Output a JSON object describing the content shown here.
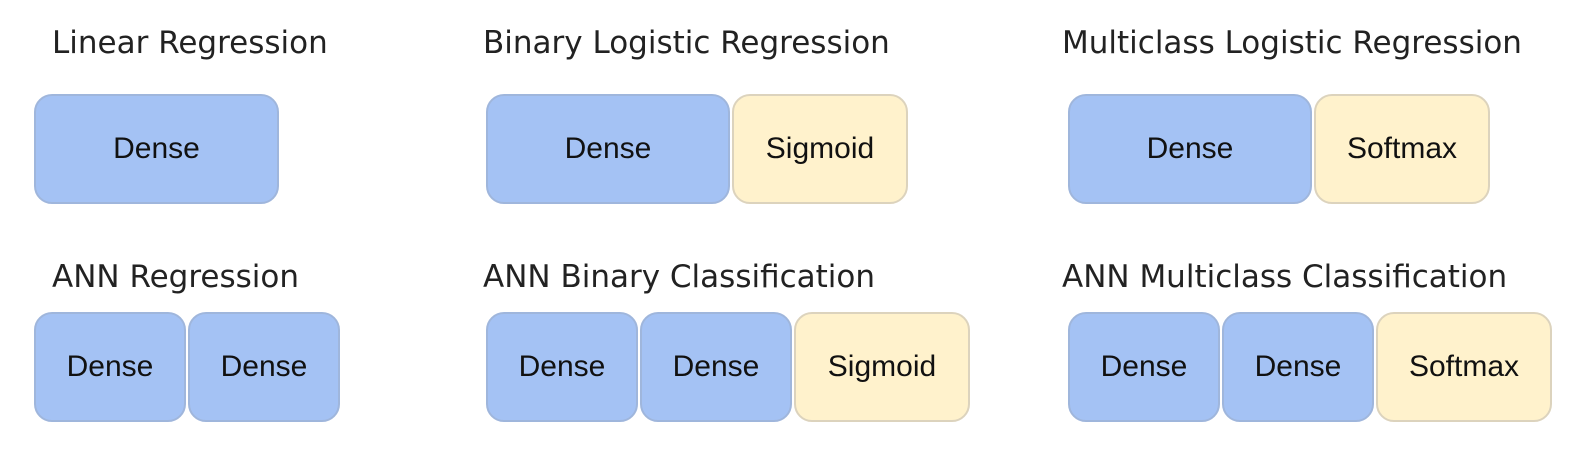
{
  "colors": {
    "dense": "#a4c2f4",
    "activation": "#fff2cc",
    "text": "#111111"
  },
  "panels": [
    {
      "title": "Linear Regression",
      "blocks": [
        {
          "label": "Dense",
          "kind": "dense"
        }
      ]
    },
    {
      "title": "Binary Logistic Regression",
      "blocks": [
        {
          "label": "Dense",
          "kind": "dense"
        },
        {
          "label": "Sigmoid",
          "kind": "activation"
        }
      ]
    },
    {
      "title": "Multiclass Logistic Regression",
      "blocks": [
        {
          "label": "Dense",
          "kind": "dense"
        },
        {
          "label": "Softmax",
          "kind": "activation"
        }
      ]
    },
    {
      "title": "ANN Regression",
      "blocks": [
        {
          "label": "Dense",
          "kind": "dense"
        },
        {
          "label": "Dense",
          "kind": "dense"
        }
      ]
    },
    {
      "title": "ANN Binary Classification",
      "blocks": [
        {
          "label": "Dense",
          "kind": "dense"
        },
        {
          "label": "Dense",
          "kind": "dense"
        },
        {
          "label": "Sigmoid",
          "kind": "activation"
        }
      ]
    },
    {
      "title": "ANN Multiclass Classification",
      "blocks": [
        {
          "label": "Dense",
          "kind": "dense"
        },
        {
          "label": "Dense",
          "kind": "dense"
        },
        {
          "label": "Softmax",
          "kind": "activation"
        }
      ]
    }
  ]
}
